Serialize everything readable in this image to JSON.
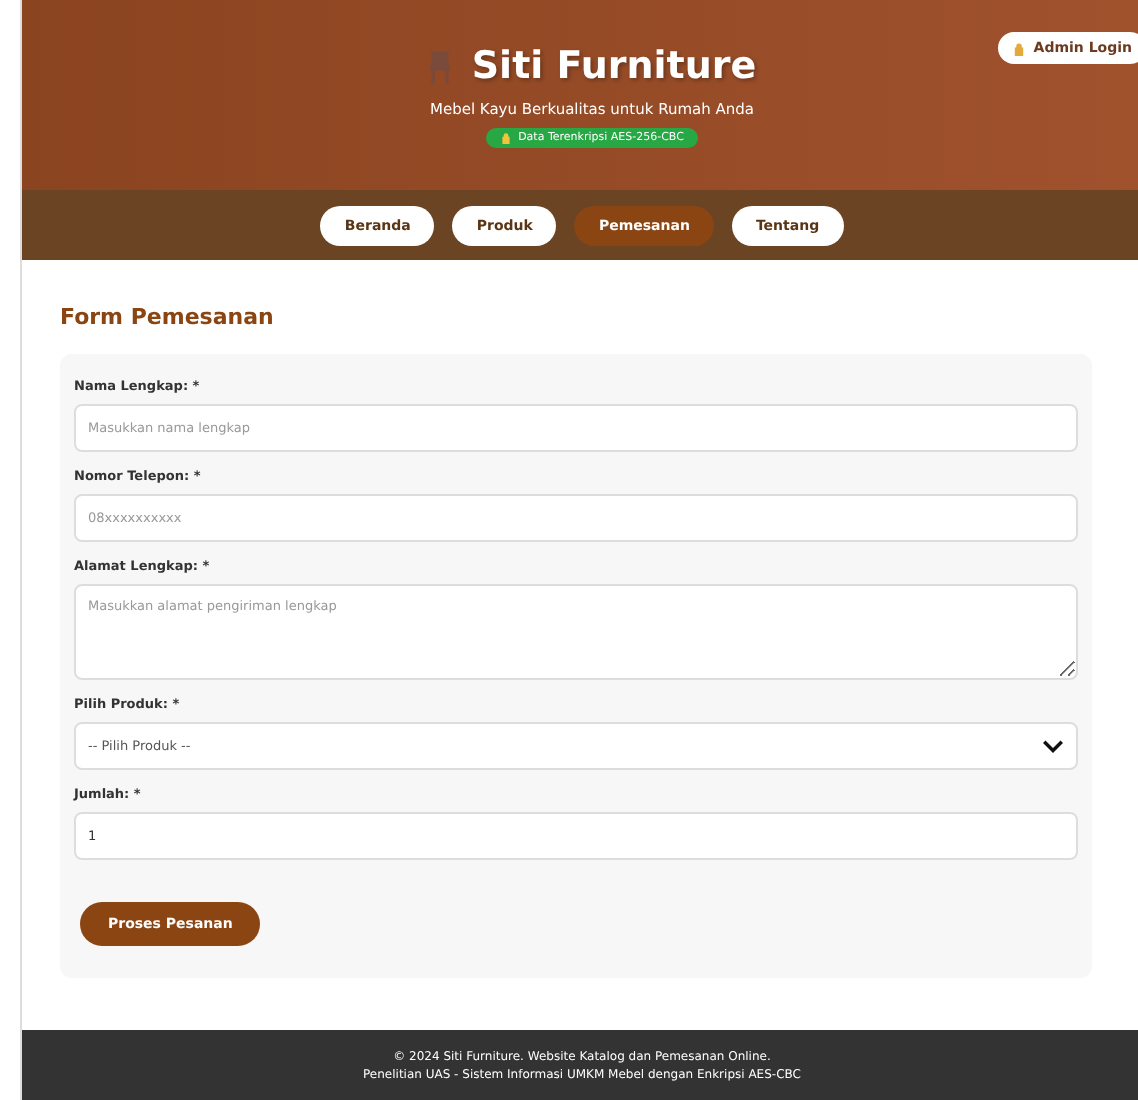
{
  "header": {
    "title": "Siti Furniture",
    "tagline": "Mebel Kayu Berkualitas untuk Rumah Anda",
    "badge": "Data Terenkripsi AES-256-CBC",
    "admin_button": "Admin Login"
  },
  "nav": [
    {
      "label": "Beranda",
      "selected": false
    },
    {
      "label": "Produk",
      "selected": false
    },
    {
      "label": "Pemesanan",
      "selected": true
    },
    {
      "label": "Tentang",
      "selected": false
    }
  ],
  "form": {
    "title": "Form Pemesanan",
    "fields": [
      {
        "kind": "text",
        "label": "Nama Lengkap: *",
        "placeholder": "Masukkan nama lengkap"
      },
      {
        "kind": "text",
        "label": "Nomor Telepon: *",
        "placeholder": "08xxxxxxxxxx"
      },
      {
        "kind": "textarea",
        "label": "Alamat Lengkap: *",
        "placeholder": "Masukkan alamat pengiriman lengkap"
      },
      {
        "kind": "select",
        "label": "Pilih Produk: *",
        "value": "-- Pilih Produk --"
      },
      {
        "kind": "number",
        "label": "Jumlah: *",
        "value": "1"
      }
    ],
    "submit": "Proses Pesanan"
  },
  "footer": [
    "© 2024 Siti Furniture. Website Katalog dan Pemesanan Online.",
    "Penelitian UAS - Sistem Informasi UMKM Mebel dengan Enkripsi AES-CBC"
  ]
}
